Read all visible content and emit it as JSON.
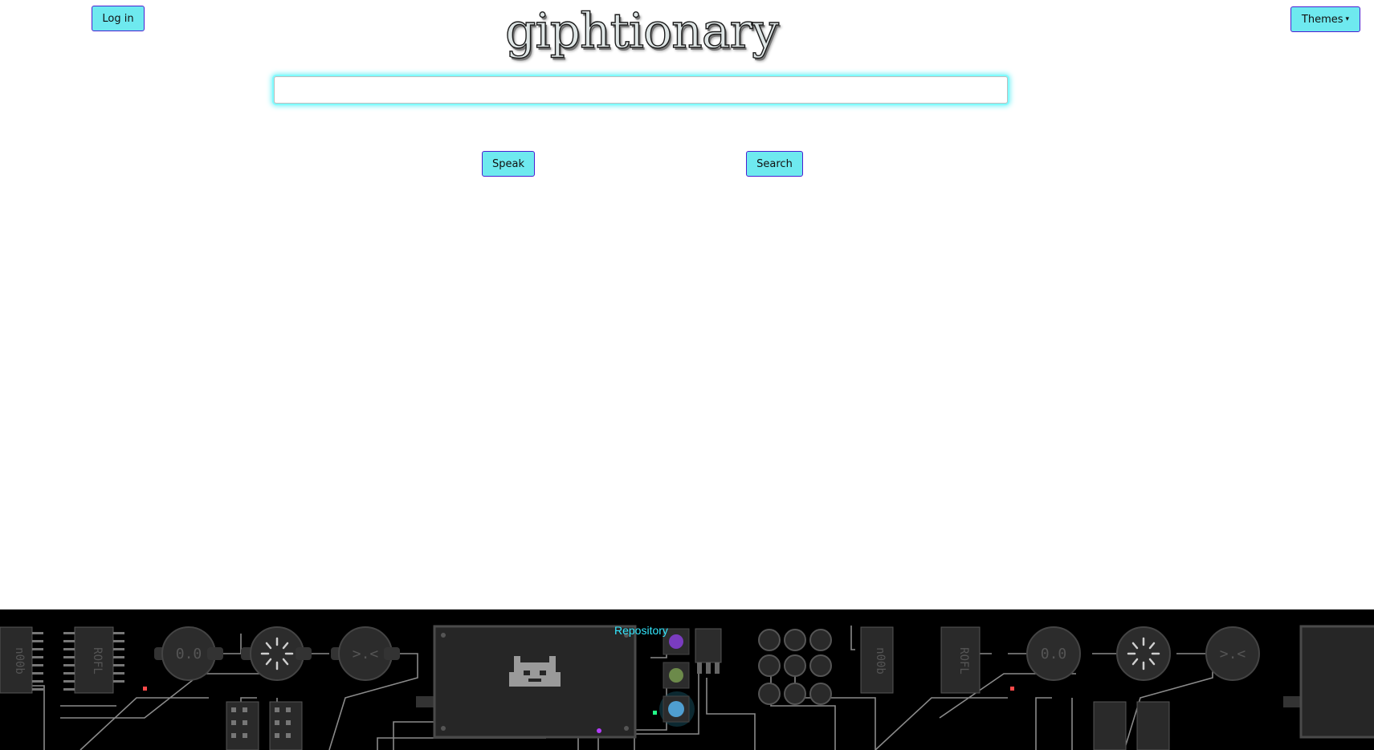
{
  "header": {
    "login_label": "Log in",
    "logo_text": "giphtionary",
    "themes_label": "Themes",
    "themes_caret": "▾"
  },
  "search": {
    "value": "",
    "placeholder": ""
  },
  "actions": {
    "speak_label": "Speak",
    "search_label": "Search"
  },
  "footer": {
    "repository_label": "Repository",
    "chip_labels": [
      "n00b",
      "ROFL",
      "0.0",
      ">.<"
    ]
  },
  "colors": {
    "button_bg": "#6ee9ef",
    "button_border": "#4b1fd1",
    "input_glow": "#6ff1f7",
    "footer_bg": "#000000",
    "link": "#33e8ff"
  }
}
